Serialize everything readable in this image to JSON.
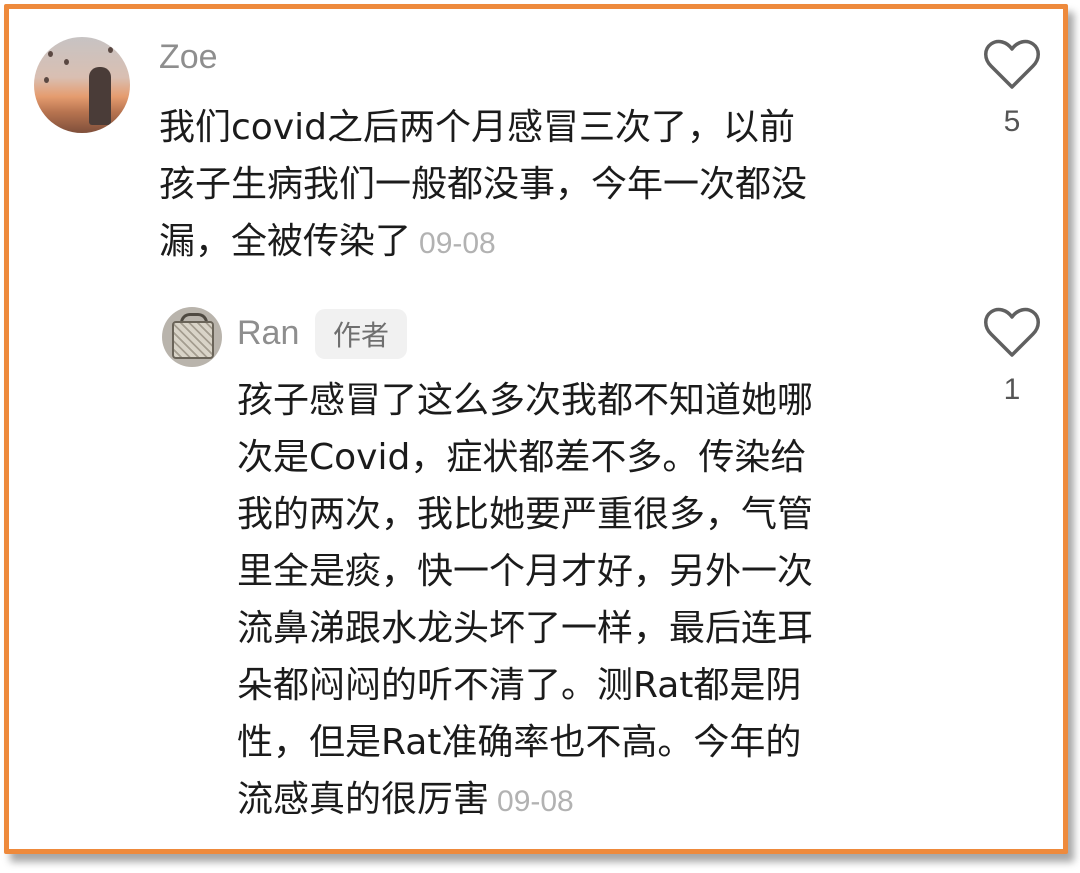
{
  "comments": [
    {
      "username": "Zoe",
      "text_lines": [
        "我们covid之后两个月感冒三次了，以前",
        "孩子生病我们一般都没事，今年一次都没",
        "漏，全被传染了"
      ],
      "date": "09-08",
      "likes": "5"
    },
    {
      "username": "Ran",
      "badge": "作者",
      "text_lines": [
        "孩子感冒了这么多次我都不知道她哪",
        "次是Covid，症状都差不多。传染给",
        "我的两次，我比她要严重很多，气管",
        "里全是痰，快一个月才好，另外一次",
        "流鼻涕跟水龙头坏了一样，最后连耳",
        "朵都闷闷的听不清了。测Rat都是阴",
        "性，但是Rat准确率也不高。今年的",
        "流感真的很厉害"
      ],
      "date": "09-08",
      "likes": "1"
    }
  ],
  "icons": {
    "like": "heart-outline-icon"
  },
  "colors": {
    "frame_border": "#ee8a3c",
    "username": "#8e8e8e",
    "text": "#1b1b1b",
    "date": "#b2b2b2"
  }
}
